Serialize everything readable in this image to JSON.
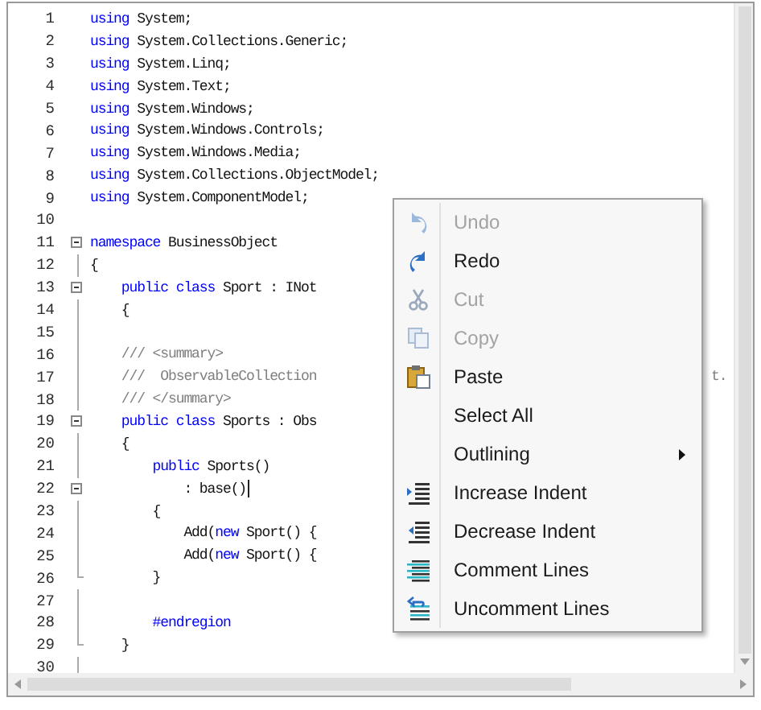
{
  "editor": {
    "lines": [
      {
        "number": "1",
        "segments": [
          {
            "kind": "keyword",
            "text": "using"
          },
          {
            "kind": "plain",
            "text": " System;"
          }
        ],
        "collapsible": false,
        "region_end": false,
        "caret": false
      },
      {
        "number": "2",
        "segments": [
          {
            "kind": "keyword",
            "text": "using"
          },
          {
            "kind": "plain",
            "text": " System.Collections.Generic;"
          }
        ],
        "collapsible": false,
        "region_end": false,
        "caret": false
      },
      {
        "number": "3",
        "segments": [
          {
            "kind": "keyword",
            "text": "using"
          },
          {
            "kind": "plain",
            "text": " System.Linq;"
          }
        ],
        "collapsible": false,
        "region_end": false,
        "caret": false
      },
      {
        "number": "4",
        "segments": [
          {
            "kind": "keyword",
            "text": "using"
          },
          {
            "kind": "plain",
            "text": " System.Text;"
          }
        ],
        "collapsible": false,
        "region_end": false,
        "caret": false
      },
      {
        "number": "5",
        "segments": [
          {
            "kind": "keyword",
            "text": "using"
          },
          {
            "kind": "plain",
            "text": " System.Windows;"
          }
        ],
        "collapsible": false,
        "region_end": false,
        "caret": false
      },
      {
        "number": "6",
        "segments": [
          {
            "kind": "keyword",
            "text": "using"
          },
          {
            "kind": "plain",
            "text": " System.Windows.Controls;"
          }
        ],
        "collapsible": false,
        "region_end": false,
        "caret": false
      },
      {
        "number": "7",
        "segments": [
          {
            "kind": "keyword",
            "text": "using"
          },
          {
            "kind": "plain",
            "text": " System.Windows.Media;"
          }
        ],
        "collapsible": false,
        "region_end": false,
        "caret": false
      },
      {
        "number": "8",
        "segments": [
          {
            "kind": "keyword",
            "text": "using"
          },
          {
            "kind": "plain",
            "text": " System.Collections.ObjectModel;"
          }
        ],
        "collapsible": false,
        "region_end": false,
        "caret": false
      },
      {
        "number": "9",
        "segments": [
          {
            "kind": "keyword",
            "text": "using"
          },
          {
            "kind": "plain",
            "text": " System.ComponentModel;"
          }
        ],
        "collapsible": false,
        "region_end": false,
        "caret": false
      },
      {
        "number": "10",
        "collapsible": false,
        "region_end": false,
        "caret": false
      },
      {
        "number": "11",
        "segments": [
          {
            "kind": "keyword",
            "text": "namespace"
          },
          {
            "kind": "plain",
            "text": " BusinessObject"
          }
        ],
        "collapsible": true,
        "region_end": false,
        "caret": false
      },
      {
        "number": "12",
        "segments": [
          {
            "kind": "plain",
            "text": "{"
          }
        ],
        "collapsible": false,
        "region_end": false,
        "caret": false
      },
      {
        "number": "13",
        "segments": [
          {
            "kind": "keyword",
            "text": "    public class"
          },
          {
            "kind": "plain",
            "text": " Sport : INot"
          }
        ],
        "collapsible": true,
        "region_end": false,
        "caret": false
      },
      {
        "number": "14",
        "segments": [
          {
            "kind": "plain",
            "text": "    {"
          }
        ],
        "collapsible": false,
        "region_end": false,
        "caret": false
      },
      {
        "number": "15",
        "collapsible": false,
        "region_end": false,
        "caret": false
      },
      {
        "number": "16",
        "segments": [
          {
            "kind": "comment",
            "text": "    /// <summary>"
          }
        ],
        "collapsible": false,
        "region_end": false,
        "caret": false
      },
      {
        "number": "17",
        "segments": [
          {
            "kind": "comment",
            "text": "    ///  ObservableCollection"
          }
        ],
        "tail": "t.",
        "collapsible": false,
        "region_end": false,
        "caret": false
      },
      {
        "number": "18",
        "segments": [
          {
            "kind": "comment",
            "text": "    /// </summary>"
          }
        ],
        "collapsible": false,
        "region_end": false,
        "caret": false
      },
      {
        "number": "19",
        "segments": [
          {
            "kind": "keyword",
            "text": "    public class"
          },
          {
            "kind": "plain",
            "text": " Sports : Obs"
          }
        ],
        "collapsible": true,
        "region_end": false,
        "caret": false
      },
      {
        "number": "20",
        "segments": [
          {
            "kind": "plain",
            "text": "    {"
          }
        ],
        "collapsible": false,
        "region_end": false,
        "caret": false
      },
      {
        "number": "21",
        "segments": [
          {
            "kind": "keyword",
            "text": "        public"
          },
          {
            "kind": "plain",
            "text": " Sports()"
          }
        ],
        "collapsible": false,
        "region_end": false,
        "caret": false
      },
      {
        "number": "22",
        "segments": [
          {
            "kind": "plain",
            "text": "            : base()"
          }
        ],
        "collapsible": true,
        "region_end": false,
        "caret": true
      },
      {
        "number": "23",
        "segments": [
          {
            "kind": "plain",
            "text": "        {"
          }
        ],
        "collapsible": false,
        "region_end": false,
        "caret": false
      },
      {
        "number": "24",
        "segments": [
          {
            "kind": "plain",
            "text": "            Add("
          },
          {
            "kind": "keyword",
            "text": "new"
          },
          {
            "kind": "plain",
            "text": " Sport() {"
          }
        ],
        "collapsible": false,
        "region_end": false,
        "caret": false
      },
      {
        "number": "25",
        "segments": [
          {
            "kind": "plain",
            "text": "            Add("
          },
          {
            "kind": "keyword",
            "text": "new"
          },
          {
            "kind": "plain",
            "text": " Sport() {"
          }
        ],
        "collapsible": false,
        "region_end": false,
        "caret": false
      },
      {
        "number": "26",
        "segments": [
          {
            "kind": "plain",
            "text": "        }"
          }
        ],
        "collapsible": false,
        "region_end": true,
        "caret": false
      },
      {
        "number": "27",
        "collapsible": false,
        "region_end": false,
        "caret": false
      },
      {
        "number": "28",
        "segments": [
          {
            "kind": "keyword",
            "text": "        #endregion"
          }
        ],
        "collapsible": false,
        "region_end": false,
        "caret": false
      },
      {
        "number": "29",
        "segments": [
          {
            "kind": "plain",
            "text": "    }"
          }
        ],
        "collapsible": false,
        "region_end": true,
        "caret": false
      },
      {
        "number": "30",
        "collapsible": false,
        "region_end": false,
        "caret": false
      }
    ]
  },
  "context_menu": {
    "items": [
      {
        "label": "Undo",
        "disabled": true,
        "submenu": false
      },
      {
        "label": "Redo",
        "disabled": false,
        "submenu": false
      },
      {
        "label": "Cut",
        "disabled": true,
        "submenu": false
      },
      {
        "label": "Copy",
        "disabled": true,
        "submenu": false
      },
      {
        "label": "Paste",
        "disabled": false,
        "submenu": false
      },
      {
        "label": "Select All",
        "disabled": false,
        "submenu": false
      },
      {
        "label": "Outlining",
        "disabled": false,
        "submenu": true
      },
      {
        "label": "Increase Indent",
        "disabled": false,
        "submenu": false
      },
      {
        "label": "Decrease Indent",
        "disabled": false,
        "submenu": false
      },
      {
        "label": "Comment Lines",
        "disabled": false,
        "submenu": false
      },
      {
        "label": "Uncomment Lines",
        "disabled": false,
        "submenu": false
      }
    ]
  }
}
